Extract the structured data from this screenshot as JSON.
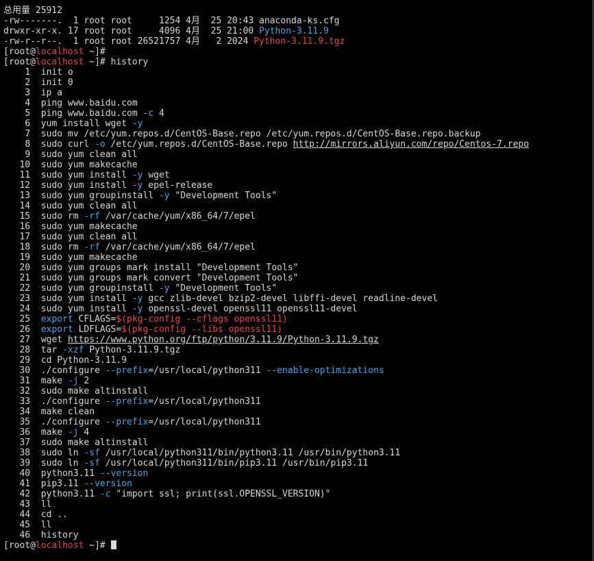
{
  "terminal": {
    "total_line": "总用量 25912",
    "ls": [
      {
        "perms": "-rw-------.",
        "links": " 1",
        "owner": "root",
        "group": "root",
        "size": "    1254",
        "month": "4月",
        "day": " 25",
        "time": "20:43",
        "name": "anaconda-ks.cfg",
        "kind": "file"
      },
      {
        "perms": "drwxr-xr-x.",
        "links": "17",
        "owner": "root",
        "group": "root",
        "size": "    4096",
        "month": "4月",
        "day": " 25",
        "time": "21:00",
        "name": "Python-3.11.9",
        "kind": "dir"
      },
      {
        "perms": "-rw-r--r--.",
        "links": " 1",
        "owner": "root",
        "group": "root",
        "size": "26521757",
        "month": "4月",
        "day": "  2",
        "time": "2024",
        "name": "Python-3.11.9.tgz",
        "kind": "archive"
      }
    ],
    "prompt": {
      "user": "root",
      "host": "localhost",
      "path": "~"
    },
    "history_command": "history",
    "history": [
      {
        "num": "1",
        "parts": [
          {
            "t": "init o"
          }
        ]
      },
      {
        "num": "2",
        "parts": [
          {
            "t": "init 0"
          }
        ]
      },
      {
        "num": "3",
        "parts": [
          {
            "t": "ip a"
          }
        ]
      },
      {
        "num": "4",
        "parts": [
          {
            "t": "ping www.baidu.com"
          }
        ]
      },
      {
        "num": "5",
        "parts": [
          {
            "t": "ping www.baidu.com "
          },
          {
            "t": "-c",
            "c": "opt"
          },
          {
            "t": " 4"
          }
        ]
      },
      {
        "num": "6",
        "parts": [
          {
            "t": "yum install wget "
          },
          {
            "t": "-y",
            "c": "opt"
          }
        ]
      },
      {
        "num": "7",
        "parts": [
          {
            "t": "sudo mv /etc/yum.repos.d/CentOS-Base.repo /etc/yum.repos.d/CentOS-Base.repo.backup"
          }
        ]
      },
      {
        "num": "8",
        "parts": [
          {
            "t": "sudo curl "
          },
          {
            "t": "-o",
            "c": "opt"
          },
          {
            "t": " /etc/yum.repos.d/CentOS-Base.repo "
          },
          {
            "t": "http://mirrors.aliyun.com/repo/Centos-7.repo",
            "c": "url"
          }
        ]
      },
      {
        "num": "9",
        "parts": [
          {
            "t": "sudo yum clean all"
          }
        ]
      },
      {
        "num": "10",
        "parts": [
          {
            "t": "sudo yum makecache"
          }
        ]
      },
      {
        "num": "11",
        "parts": [
          {
            "t": "sudo yum install "
          },
          {
            "t": "-y",
            "c": "opt"
          },
          {
            "t": " wget"
          }
        ]
      },
      {
        "num": "12",
        "parts": [
          {
            "t": "sudo yum install "
          },
          {
            "t": "-y",
            "c": "opt"
          },
          {
            "t": " epel-release"
          }
        ]
      },
      {
        "num": "13",
        "parts": [
          {
            "t": "sudo yum groupinstall "
          },
          {
            "t": "-y",
            "c": "opt"
          },
          {
            "t": " \"Development Tools\""
          }
        ]
      },
      {
        "num": "14",
        "parts": [
          {
            "t": "sudo yum clean all"
          }
        ]
      },
      {
        "num": "15",
        "parts": [
          {
            "t": "sudo rm "
          },
          {
            "t": "-rf",
            "c": "opt"
          },
          {
            "t": " /var/cache/yum/x86_64/7/epel"
          }
        ]
      },
      {
        "num": "16",
        "parts": [
          {
            "t": "sudo yum makecache"
          }
        ]
      },
      {
        "num": "17",
        "parts": [
          {
            "t": "sudo yum clean all"
          }
        ]
      },
      {
        "num": "18",
        "parts": [
          {
            "t": "sudo rm "
          },
          {
            "t": "-rf",
            "c": "opt"
          },
          {
            "t": " /var/cache/yum/x86_64/7/epel"
          }
        ]
      },
      {
        "num": "19",
        "parts": [
          {
            "t": "sudo yum makecache"
          }
        ]
      },
      {
        "num": "20",
        "parts": [
          {
            "t": "sudo yum groups mark install \"Development Tools\""
          }
        ]
      },
      {
        "num": "21",
        "parts": [
          {
            "t": "sudo yum groups mark convert \"Development Tools\""
          }
        ]
      },
      {
        "num": "22",
        "parts": [
          {
            "t": "sudo yum groupinstall "
          },
          {
            "t": "-y",
            "c": "opt"
          },
          {
            "t": " \"Development Tools\""
          }
        ]
      },
      {
        "num": "23",
        "parts": [
          {
            "t": "sudo yum install "
          },
          {
            "t": "-y",
            "c": "opt"
          },
          {
            "t": " gcc zlib-devel bzip2-devel libffi-devel readline-devel"
          }
        ]
      },
      {
        "num": "24",
        "parts": [
          {
            "t": "sudo yum install "
          },
          {
            "t": "-y",
            "c": "opt"
          },
          {
            "t": " openssl-devel openssl11 openssl11-devel"
          }
        ]
      },
      {
        "num": "25",
        "parts": [
          {
            "t": "export",
            "c": "kw"
          },
          {
            "t": " CFLAGS="
          },
          {
            "t": "$(pkg-config --cflags openssl11)",
            "c": "ex"
          }
        ]
      },
      {
        "num": "26",
        "parts": [
          {
            "t": "export",
            "c": "kw"
          },
          {
            "t": " LDFLAGS="
          },
          {
            "t": "$(pkg-config --libs openssl11)",
            "c": "ex"
          }
        ]
      },
      {
        "num": "27",
        "parts": [
          {
            "t": "wget "
          },
          {
            "t": "https://www.python.org/ftp/python/3.11.9/Python-3.11.9.tgz",
            "c": "url"
          }
        ]
      },
      {
        "num": "28",
        "parts": [
          {
            "t": "tar "
          },
          {
            "t": "-xzf",
            "c": "opt"
          },
          {
            "t": " Python-3.11.9.tgz"
          }
        ]
      },
      {
        "num": "29",
        "parts": [
          {
            "t": "cd Python-3.11.9"
          }
        ]
      },
      {
        "num": "30",
        "parts": [
          {
            "t": "./configure "
          },
          {
            "t": "--prefix",
            "c": "opt"
          },
          {
            "t": "=/usr/local/python311 "
          },
          {
            "t": "--enable-optimizations",
            "c": "opt"
          }
        ]
      },
      {
        "num": "31",
        "parts": [
          {
            "t": "make "
          },
          {
            "t": "-j",
            "c": "opt"
          },
          {
            "t": " 2"
          }
        ]
      },
      {
        "num": "32",
        "parts": [
          {
            "t": "sudo make altinstall"
          }
        ]
      },
      {
        "num": "33",
        "parts": [
          {
            "t": "./configure "
          },
          {
            "t": "--prefix",
            "c": "opt"
          },
          {
            "t": "=/usr/local/python311"
          }
        ]
      },
      {
        "num": "34",
        "parts": [
          {
            "t": "make clean"
          }
        ]
      },
      {
        "num": "35",
        "parts": [
          {
            "t": "./configure "
          },
          {
            "t": "--prefix",
            "c": "opt"
          },
          {
            "t": "=/usr/local/python311"
          }
        ]
      },
      {
        "num": "36",
        "parts": [
          {
            "t": "make "
          },
          {
            "t": "-j",
            "c": "opt"
          },
          {
            "t": " 4"
          }
        ]
      },
      {
        "num": "37",
        "parts": [
          {
            "t": "sudo make altinstall"
          }
        ]
      },
      {
        "num": "38",
        "parts": [
          {
            "t": "sudo ln "
          },
          {
            "t": "-sf",
            "c": "opt"
          },
          {
            "t": " /usr/local/python311/bin/python3.11 /usr/bin/python3.11"
          }
        ]
      },
      {
        "num": "39",
        "parts": [
          {
            "t": "sudo ln "
          },
          {
            "t": "-sf",
            "c": "opt"
          },
          {
            "t": " /usr/local/python311/bin/pip3.11 /usr/bin/pip3.11"
          }
        ]
      },
      {
        "num": "40",
        "parts": [
          {
            "t": "python3.11 "
          },
          {
            "t": "--version",
            "c": "opt"
          }
        ]
      },
      {
        "num": "41",
        "parts": [
          {
            "t": "pip3.11 "
          },
          {
            "t": "--version",
            "c": "opt"
          }
        ]
      },
      {
        "num": "42",
        "parts": [
          {
            "t": "python3.11 "
          },
          {
            "t": "-c",
            "c": "opt"
          },
          {
            "t": " \"import ssl; print(ssl.OPENSSL_VERSION)\""
          }
        ]
      },
      {
        "num": "43",
        "parts": [
          {
            "t": "ll"
          }
        ]
      },
      {
        "num": "44",
        "parts": [
          {
            "t": "cd .."
          }
        ]
      },
      {
        "num": "45",
        "parts": [
          {
            "t": "ll"
          }
        ]
      },
      {
        "num": "46",
        "parts": [
          {
            "t": "history"
          }
        ]
      }
    ]
  },
  "colors": {
    "background": "#000000",
    "foreground": "#d8d8d8",
    "option": "#4aa3df",
    "host": "#e04848",
    "directory": "#4aa3df",
    "archive": "#e04848"
  }
}
